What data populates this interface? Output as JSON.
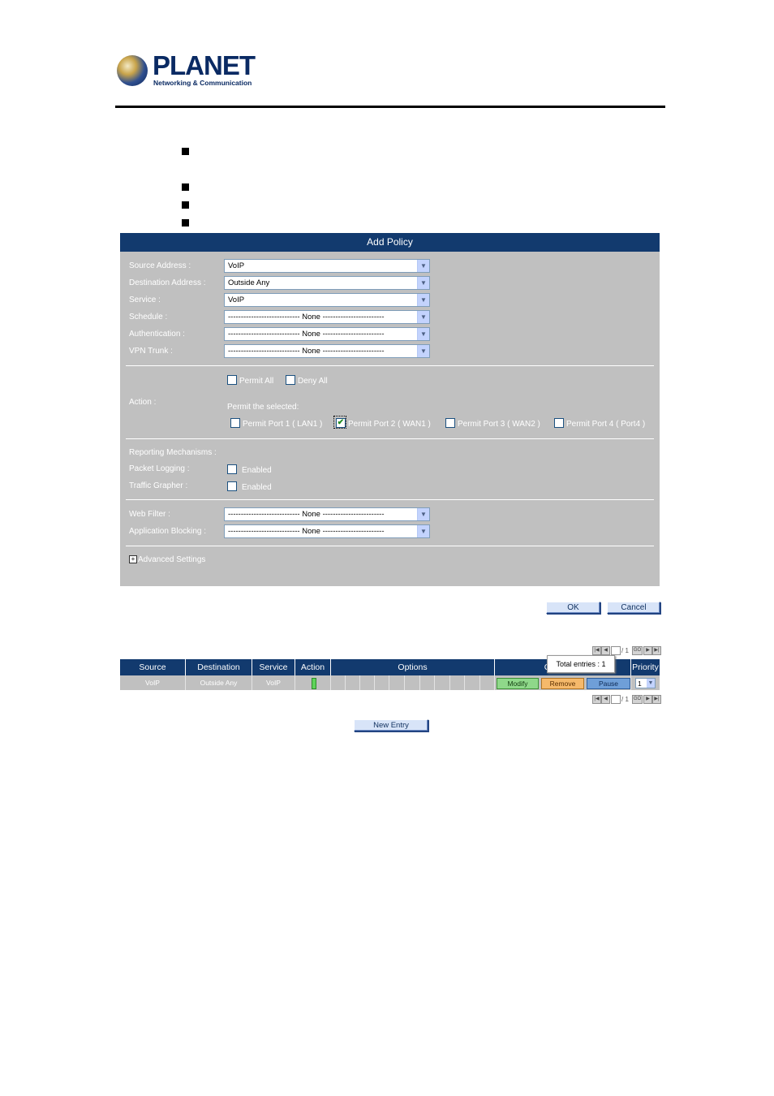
{
  "logo": {
    "word": "PLANET",
    "sub": "Networking & Communication"
  },
  "panel": {
    "title": "Add Policy",
    "fields": [
      {
        "label": "Source Address :",
        "value": "VoIP"
      },
      {
        "label": "Destination Address :",
        "value": "Outside Any"
      },
      {
        "label": "Service :",
        "value": "VoIP"
      },
      {
        "label": "Schedule :",
        "value": "---------------------------- None ------------------------"
      },
      {
        "label": "Authentication :",
        "value": "---------------------------- None ------------------------"
      },
      {
        "label": "VPN Trunk :",
        "value": "---------------------------- None ------------------------"
      }
    ],
    "action": {
      "label": "Action :",
      "permit_all": "Permit All",
      "deny_all": "Deny All",
      "permit_selected": "Permit the selected:",
      "ports": [
        {
          "label": "Permit Port  1  ( LAN1 )",
          "checked": false
        },
        {
          "label": "Permit Port  2  ( WAN1 )",
          "checked": true
        },
        {
          "label": "Permit Port  3  ( WAN2 )",
          "checked": false
        },
        {
          "label": "Permit Port  4  ( Port4 )",
          "checked": false
        }
      ]
    },
    "reporting": {
      "title": "Reporting Mechanisms :",
      "packet_logging": "Packet Logging :",
      "traffic_grapher": "Traffic Grapher :",
      "enabled": "Enabled"
    },
    "web_filter": {
      "label": "Web Filter :",
      "value": "---------------------------- None ------------------------"
    },
    "app_blocking": {
      "label": "Application Blocking :",
      "value": "---------------------------- None ------------------------"
    },
    "advanced": {
      "icon": "+",
      "label": "Advanced Settings"
    }
  },
  "buttons": {
    "ok": "OK",
    "cancel": "Cancel",
    "new_entry": "New Entry"
  },
  "pager": {
    "first": "|◀",
    "prev": "◀",
    "page": "",
    "of": "/ 1",
    "go": "GO",
    "next": "▶",
    "last": "▶|"
  },
  "tooltip": "Total entries : 1",
  "table": {
    "headers": [
      "Source",
      "Destination",
      "Service",
      "Action",
      "Options",
      "Configure",
      "Priority"
    ],
    "row": {
      "source": "VoIP",
      "destination": "Outside Any",
      "service": "VoIP",
      "modify": "Modify",
      "remove": "Remove",
      "pause": "Pause",
      "priority": "1"
    }
  },
  "colors": {
    "header_bg": "#123a6e",
    "panel_bg": "#c0c0c0",
    "modify": "#8fd88a",
    "remove": "#f5b96b",
    "pause": "#6f9fd8"
  }
}
